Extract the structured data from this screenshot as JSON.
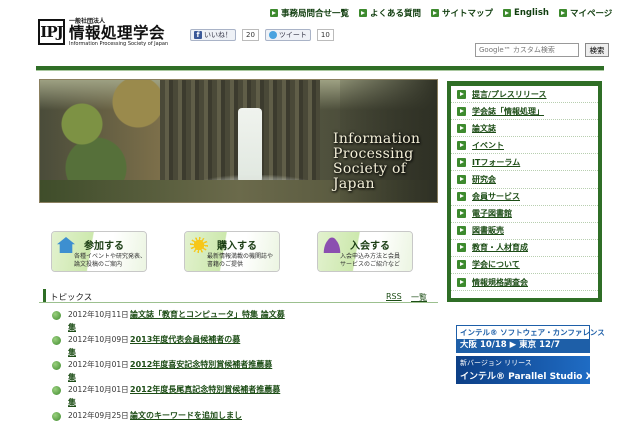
{
  "topnav": [
    {
      "label": "事務局問合せ一覧"
    },
    {
      "label": "よくある質問"
    },
    {
      "label": "サイトマップ"
    },
    {
      "label": "English"
    },
    {
      "label": "マイページ"
    }
  ],
  "logo": {
    "mark": "IPSJ",
    "sub": "一般社団法人",
    "main": "情報処理学会",
    "en": "Information Processing Society of Japan"
  },
  "social": {
    "like_label": "いいね！",
    "like_count": "20",
    "tweet_label": "ツイート",
    "tweet_count": "10"
  },
  "search": {
    "placeholder": "Google™ カスタム検索",
    "button": "検索"
  },
  "hero": {
    "line1": "Information",
    "line2": "Processing",
    "line3": "Society of",
    "line4": "Japan"
  },
  "actions": [
    {
      "title": "参加する",
      "desc1": "各種イベントや研究発表、",
      "desc2": "論文投稿のご案内"
    },
    {
      "title": "購入する",
      "desc1": "最新情報満載の機関誌や",
      "desc2": "書籍のご提供"
    },
    {
      "title": "入会する",
      "desc1": "入会申込み方法と会員",
      "desc2": "サービスのご紹介など"
    }
  ],
  "topics": {
    "heading": "トピックス",
    "rss": "RSS",
    "all": "一覧",
    "items": [
      {
        "date": "2012年10月11日",
        "title": "論文誌「教育とコンピュータ」特集 論文募",
        "cont": "集"
      },
      {
        "date": "2012年10月09日",
        "title": "2013年度代表会員候補者の募",
        "cont": "集"
      },
      {
        "date": "2012年10月01日",
        "title": "2012年度喜安記念特別賞候補者推薦募",
        "cont": "集"
      },
      {
        "date": "2012年10月01日",
        "title": "2012年度長尾真記念特別賞候補者推薦募",
        "cont": "集"
      },
      {
        "date": "2012年09月25日",
        "title": "論文のキーワードを追加しまし",
        "cont": ""
      }
    ]
  },
  "sidemenu": [
    {
      "label": "提言/プレスリリース"
    },
    {
      "label": "学会誌「情報処理」"
    },
    {
      "label": "論文誌"
    },
    {
      "label": "イベント"
    },
    {
      "label": "ITフォーラム"
    },
    {
      "label": "研究会"
    },
    {
      "label": "会員サービス"
    },
    {
      "label": "電子図書館"
    },
    {
      "label": "図書販売"
    },
    {
      "label": "教育・人材育成"
    },
    {
      "label": "学会について"
    },
    {
      "label": "情報規格調査会"
    }
  ],
  "banner1": {
    "line1": "インテル® ソフトウェア・カンファレンス",
    "line2": "大阪 10/18 ▶ 東京 12/7"
  },
  "banner2": {
    "line1": "新バージョン リリース",
    "line2": "インテル® Parallel Studio XE"
  }
}
